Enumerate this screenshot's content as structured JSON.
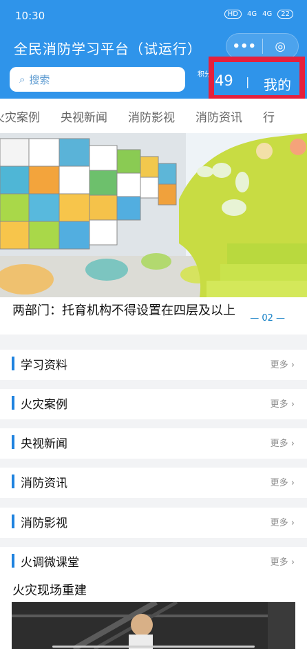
{
  "status_bar": {
    "time": "10:30",
    "signals": [
      "HD",
      "4G",
      "4G",
      "22"
    ]
  },
  "header": {
    "title": "全民消防学习平台（试运行）",
    "more_icon": "•••",
    "scan_icon": "◎"
  },
  "search": {
    "placeholder": "搜索"
  },
  "score": {
    "label": "积分",
    "value": "49"
  },
  "mine": {
    "label": "我的"
  },
  "tabs": [
    "火灾案例",
    "央视新闻",
    "消防影视",
    "消防资讯",
    "行"
  ],
  "banner": {
    "title": "两部门：托育机构不得设置在四层及以上",
    "page": "— 02 —"
  },
  "sections": [
    {
      "label": "学习资料",
      "more": "更多"
    },
    {
      "label": "火灾案例",
      "more": "更多"
    },
    {
      "label": "央视新闻",
      "more": "更多"
    },
    {
      "label": "消防资讯",
      "more": "更多"
    },
    {
      "label": "消防影视",
      "more": "更多"
    },
    {
      "label": "火调微课堂",
      "more": "更多"
    }
  ],
  "article": {
    "title": "火灾现场重建"
  }
}
